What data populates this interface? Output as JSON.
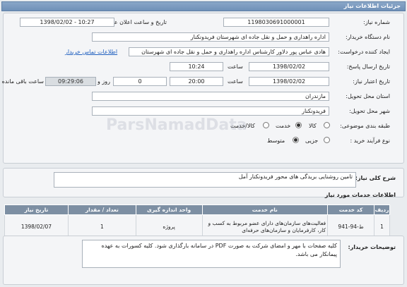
{
  "header": {
    "title": "جزئیات اطلاعات نیاز"
  },
  "form": {
    "need_number_label": "شماره نیاز:",
    "need_number": "1198030691000001",
    "announce_label": "تاریخ و ساعت اعلان عمومی:",
    "announce_value": "1398/02/02 - 10:27",
    "buyer_label": "نام دستگاه خریدار:",
    "buyer_value": "اداره راهداری و حمل و نقل جاده ای شهرستان فریدونکنار",
    "creator_label": "ایجاد کننده درخواست:",
    "creator_value": "هادی عباس پور دلاور کارشناس اداره راهداری و حمل و نقل جاده ای شهرستان",
    "contact_link": "اطلاعات تماس خریدار",
    "send_deadline_label": "تاریخ ارسال پاسخ:",
    "send_date": "1398/02/02",
    "time_label": "ساعت",
    "send_time": "10:24",
    "validity_label": "تاریخ اعتبار نیاز:",
    "validity_date": "1398/02/02",
    "validity_time": "20:00",
    "days_value": "0",
    "days_label": "روز و",
    "remaining_time": "09:29:06",
    "remaining_label": "ساعت باقی مانده",
    "province_label": "استان محل تحویل:",
    "province_value": "مازندران",
    "city_label": "شهر محل تحویل:",
    "city_value": "فریدونکنار",
    "category_label": "طبقه بندی موضوعی:",
    "category_options": [
      "کالا",
      "خدمت",
      "کالا/خدمت"
    ],
    "process_label": "نوع فرآیند خرید :",
    "process_options": [
      "جزیی",
      "متوسط"
    ]
  },
  "description": {
    "label": "شرح کلی نیاز:",
    "value": "تامین روشنایی بریدگی های محور فریدونکنار آمل",
    "services_title": "اطلاعات خدمات مورد نیاز"
  },
  "table": {
    "headers": [
      "ردیف",
      "کد خدمت",
      "نام خدمت",
      "واحد اندازه گیری",
      "تعداد / مقدار",
      "تاریخ نیاز"
    ],
    "rows": [
      {
        "row": "1",
        "code": "ط-94-941",
        "name": "فعالیت‌های سازمان‌های دارای عضو مربوط به کسب و کار، کارفرمایان و سازمان‌های حرفه‌ای",
        "unit": "پروژه",
        "qty": "1",
        "date": "1398/02/07"
      }
    ]
  },
  "notes": {
    "label": "توضیحات خریدار:",
    "value": "کلیه صفحات با مهر و امضای شرکت به صورت PDF در سامانه بارگذاری شود. کلیه کسورات به عهده پیمانکار می باشد."
  },
  "watermark": "ParsNamadData"
}
